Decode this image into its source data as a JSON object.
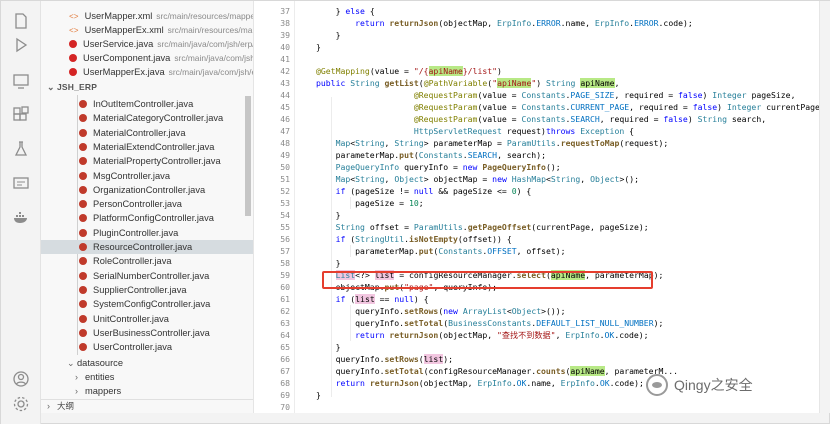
{
  "sidebar": {
    "open_files": [
      {
        "name": "UserMapper.xml",
        "path": "src/main/resources/mappe..."
      },
      {
        "name": "UserMapperEx.xml",
        "path": "src/main/resources/ma..."
      },
      {
        "name": "UserService.java",
        "path": "src/main/java/com/jsh/erp/..."
      },
      {
        "name": "UserComponent.java",
        "path": "src/main/java/com/jsh/erp..."
      },
      {
        "name": "UserMapperEx.java",
        "path": "src/main/java/com/jsh/e..."
      }
    ],
    "project_header": "JSH_ERP",
    "controllers": [
      "InOutItemController.java",
      "MaterialCategoryController.java",
      "MaterialController.java",
      "MaterialExtendController.java",
      "MaterialPropertyController.java",
      "MsgController.java",
      "OrganizationController.java",
      "PersonController.java",
      "PlatformConfigController.java",
      "PluginController.java",
      "ResourceController.java",
      "RoleController.java",
      "SerialNumberController.java",
      "SupplierController.java",
      "SystemConfigController.java",
      "UnitController.java",
      "UserBusinessController.java",
      "UserController.java"
    ],
    "folders": [
      "datasource",
      "entities",
      "mappers"
    ],
    "outline_label": "大纲"
  },
  "editor": {
    "lines": [
      {
        "n": "37",
        "html": "    } <span class='kw'>else</span> {"
      },
      {
        "n": "38",
        "html": "        <span class='kw'>return</span> <span class='fn'>returnJson</span>(objectMap, <span class='ty'>ErpInfo</span>.<span class='cst'>ERROR</span>.name, <span class='ty'>ErpInfo</span>.<span class='cst'>ERROR</span>.code);"
      },
      {
        "n": "39",
        "html": "    }"
      },
      {
        "n": "40",
        "html": "}"
      },
      {
        "n": "41",
        "html": ""
      },
      {
        "n": "42",
        "html": "<span class='ann'>@GetMapping</span>(value = <span class='str'>\"/{<span class='hl-green'>apiName</span>}/list\"</span>)"
      },
      {
        "n": "43",
        "html": "<span class='kw'>public</span> <span class='ty'>String</span> <span class='fn'>getList</span>(<span class='ann'>@PathVariable</span>(<span class='str'>\"<span class='hl-green'>apiName</span>\"</span>) <span class='ty'>String</span> <span class='hl-green'>apiName</span>,"
      },
      {
        "n": "44",
        "html": "                    <span class='ann'>@RequestParam</span>(value = <span class='ty'>Constants</span>.<span class='cst'>PAGE_SIZE</span>, required = <span class='kw'>false</span>) <span class='ty'>Integer</span> pageSize,"
      },
      {
        "n": "45",
        "html": "                    <span class='ann'>@RequestParam</span>(value = <span class='ty'>Constants</span>.<span class='cst'>CURRENT_PAGE</span>, required = <span class='kw'>false</span>) <span class='ty'>Integer</span> currentPage,"
      },
      {
        "n": "46",
        "html": "                    <span class='ann'>@RequestParam</span>(value = <span class='ty'>Constants</span>.<span class='cst'>SEARCH</span>, required = <span class='kw'>false</span>) <span class='ty'>String</span> search,"
      },
      {
        "n": "47",
        "html": "                    <span class='ty'>HttpServletRequest</span> request)<span class='kw'>throws</span> <span class='ty'>Exception</span> {"
      },
      {
        "n": "48",
        "html": "    <span class='ty'>Map</span>&lt;<span class='ty'>String</span>, <span class='ty'>String</span>&gt; parameterMap = <span class='ty'>ParamUtils</span>.<span class='fn'>requestToMap</span>(request);"
      },
      {
        "n": "49",
        "html": "    parameterMap.<span class='fn'>put</span>(<span class='ty'>Constants</span>.<span class='cst'>SEARCH</span>, search);"
      },
      {
        "n": "50",
        "html": "    <span class='ty'>PageQueryInfo</span> queryInfo = <span class='kw'>new</span> <span class='fn'>PageQueryInfo</span>();"
      },
      {
        "n": "51",
        "html": "    <span class='ty'>Map</span>&lt;<span class='ty'>String</span>, <span class='ty'>Object</span>&gt; objectMap = <span class='kw'>new</span> <span class='ty'>HashMap</span>&lt;<span class='ty'>String</span>, <span class='ty'>Object</span>&gt;();"
      },
      {
        "n": "52",
        "html": "    <span class='kw'>if</span> (pageSize != <span class='kw'>null</span> &amp;&amp; pageSize &lt;= <span class='num'>0</span>) {"
      },
      {
        "n": "53",
        "html": "        pageSize = <span class='num'>10</span>;"
      },
      {
        "n": "54",
        "html": "    }"
      },
      {
        "n": "55",
        "html": "    <span class='ty'>String</span> offset = <span class='ty'>ParamUtils</span>.<span class='fn'>getPageOffset</span>(currentPage, pageSize);"
      },
      {
        "n": "56",
        "html": "    <span class='kw'>if</span> (<span class='ty'>StringUtil</span>.<span class='fn'>isNotEmpty</span>(offset)) {"
      },
      {
        "n": "57",
        "html": "        parameterMap.<span class='fn'>put</span>(<span class='ty'>Constants</span>.<span class='cst'>OFFSET</span>, offset);"
      },
      {
        "n": "58",
        "html": "    }"
      },
      {
        "n": "59",
        "html": "    <span class='hl-pink'><span class='ty'>List</span></span>&lt;?&gt; <span class='hl-pink'>list</span> = configResourceManager.<span class='fn'>select</span>(<span class='hl-green'>apiName</span>, parameterMap);"
      },
      {
        "n": "60",
        "html": "    objectMap.<span class='fn'>put</span>(<span class='str'>\"page\"</span>, queryInfo);"
      },
      {
        "n": "61",
        "html": "    <span class='kw'>if</span> (<span class='hl-pink'>list</span> == <span class='kw'>null</span>) {"
      },
      {
        "n": "62",
        "html": "        queryInfo.<span class='fn'>setRows</span>(<span class='kw'>new</span> <span class='ty'>ArrayList</span>&lt;<span class='ty'>Object</span>&gt;());"
      },
      {
        "n": "63",
        "html": "        queryInfo.<span class='fn'>setTotal</span>(<span class='ty'>BusinessConstants</span>.<span class='cst'>DEFAULT_LIST_NULL_NUMBER</span>);"
      },
      {
        "n": "64",
        "html": "        <span class='kw'>return</span> <span class='fn'>returnJson</span>(objectMap, <span class='str'>\"查找不到数据\"</span>, <span class='ty'>ErpInfo</span>.<span class='cst'>OK</span>.code);"
      },
      {
        "n": "65",
        "html": "    }"
      },
      {
        "n": "66",
        "html": "    queryInfo.<span class='fn'>setRows</span>(<span class='hl-pink'>list</span>);"
      },
      {
        "n": "67",
        "html": "    queryInfo.<span class='fn'>setTotal</span>(configResourceManager.<span class='fn'>counts</span>(<span class='hl-green'>apiName</span>, parameterM..."
      },
      {
        "n": "68",
        "html": "    <span class='kw'>return</span> <span class='fn'>returnJson</span>(objectMap, <span class='ty'>ErpInfo</span>.<span class='cst'>OK</span>.name, <span class='ty'>ErpInfo</span>.<span class='cst'>OK</span>.code);"
      },
      {
        "n": "69",
        "html": "}"
      },
      {
        "n": "70",
        "html": ""
      }
    ]
  },
  "watermark": "Qingy之安全",
  "colors": {
    "highlight_box": "#e53e2e",
    "match_highlight": "#b8e986",
    "symbol_highlight": "#f2c6e0"
  }
}
